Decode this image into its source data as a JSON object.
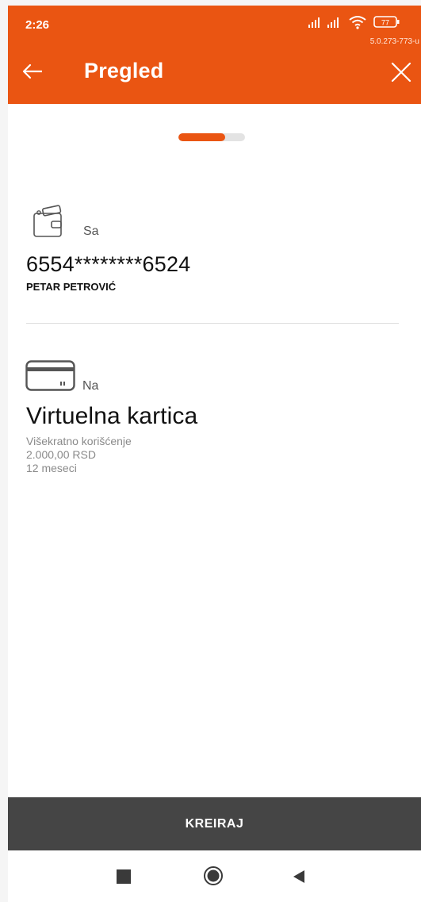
{
  "status_bar": {
    "time": "2:26",
    "battery_level": "77",
    "version": "5.0.273-773-u"
  },
  "header": {
    "title": "Pregled",
    "back_icon": "arrow-left-icon",
    "close_icon": "close-icon"
  },
  "progress": {
    "completed_fraction": 0.7
  },
  "from_section": {
    "label": "Sa",
    "icon": "wallet-icon",
    "account_number": "6554********6524",
    "owner_name": "PETAR PETROVIĆ"
  },
  "to_section": {
    "label": "Na",
    "icon": "card-icon",
    "name": "Virtuelna kartica",
    "usage": "Višekratno korišćenje",
    "amount": "2.000,00 RSD",
    "duration": "12 meseci"
  },
  "actions": {
    "primary_label": "KREIRAJ"
  },
  "navbar": {
    "recent_icon": "square-icon",
    "home_icon": "home-circle-icon",
    "back_icon": "back-triangle-icon"
  },
  "colors": {
    "accent": "#ea5512",
    "button_bg": "#454545"
  }
}
